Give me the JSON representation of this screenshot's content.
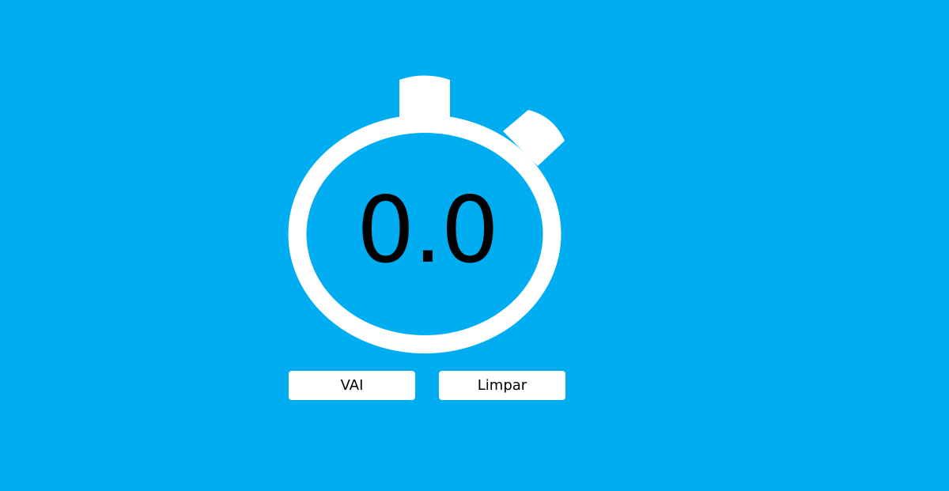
{
  "timer": {
    "display_value": "0.0"
  },
  "controls": {
    "start_label": "VAI",
    "clear_label": "Limpar"
  },
  "icons": {
    "stopwatch": "stopwatch-icon"
  },
  "colors": {
    "background": "#00adf0",
    "stopwatch": "#ffffff",
    "text": "#000000",
    "button_bg": "#ffffff"
  }
}
